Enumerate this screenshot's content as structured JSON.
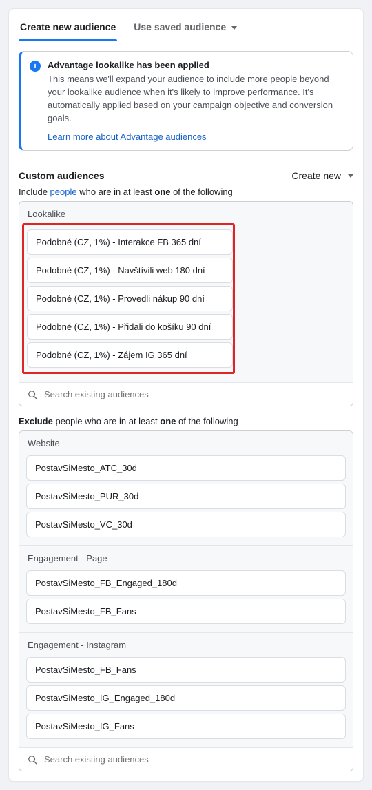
{
  "tabs": {
    "create": "Create new audience",
    "saved": "Use saved audience"
  },
  "banner": {
    "title": "Advantage lookalike has been applied",
    "body": "This means we'll expand your audience to include more people beyond your lookalike audience when it's likely to improve performance. It's automatically applied based on your campaign objective and conversion goals.",
    "link": "Learn more about Advantage audiences"
  },
  "custom": {
    "title": "Custom audiences",
    "create_new": "Create new",
    "include_pre": "Include ",
    "include_link": "people",
    "include_mid": " who are in at least ",
    "include_bold": "one",
    "include_post": " of the following"
  },
  "include": {
    "group_label": "Lookalike",
    "items": [
      "Podobné (CZ, 1%) - Interakce FB 365 dní",
      "Podobné (CZ, 1%) - Navštívili web 180 dní",
      "Podobné (CZ, 1%) - Provedli nákup 90 dní",
      "Podobné (CZ, 1%) - Přidali do košíku 90 dní",
      "Podobné (CZ, 1%) - Zájem IG 365 dní"
    ],
    "search_placeholder": "Search existing audiences"
  },
  "exclude": {
    "line_pre": "Exclude",
    "line_mid1": " people who are in at least ",
    "line_bold": "one",
    "line_post": " of the following",
    "groups": [
      {
        "label": "Website",
        "items": [
          "PostavSiMesto_ATC_30d",
          "PostavSiMesto_PUR_30d",
          "PostavSiMesto_VC_30d"
        ]
      },
      {
        "label": "Engagement - Page",
        "items": [
          "PostavSiMesto_FB_Engaged_180d",
          "PostavSiMesto_FB_Fans"
        ]
      },
      {
        "label": "Engagement - Instagram",
        "items": [
          "PostavSiMesto_FB_Fans",
          "PostavSiMesto_IG_Engaged_180d",
          "PostavSiMesto_IG_Fans"
        ]
      }
    ],
    "search_placeholder": "Search existing audiences"
  }
}
